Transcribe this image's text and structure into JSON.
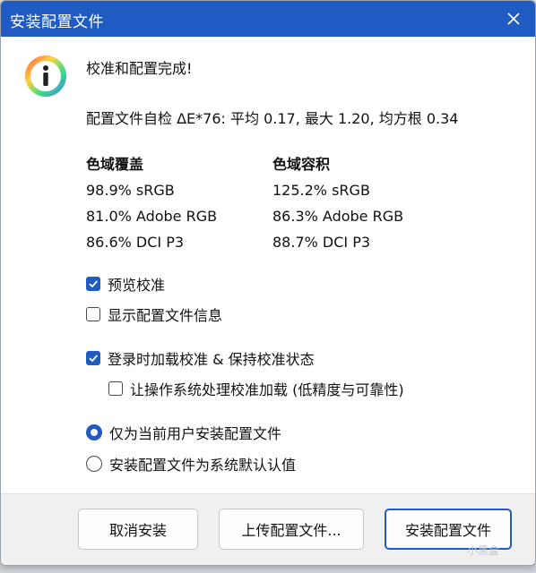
{
  "window": {
    "title": "安装配置文件"
  },
  "summary": {
    "heading": "校准和配置完成!",
    "self_check": "配置文件自检 ΔE*76: 平均 0.17, 最大 1.20, 均方根 0.34"
  },
  "gamut_coverage": {
    "title": "色域覆盖",
    "lines": [
      "98.9% sRGB",
      "81.0% Adobe RGB",
      "86.6% DCI P3"
    ]
  },
  "gamut_volume": {
    "title": "色域容积",
    "lines": [
      "125.2% sRGB",
      "86.3% Adobe RGB",
      "88.7% DCI P3"
    ]
  },
  "options": {
    "preview": {
      "label": "预览校准",
      "checked": true
    },
    "show_info": {
      "label": "显示配置文件信息",
      "checked": false
    },
    "load_on_login": {
      "label": "登录时加载校准 & 保持校准状态",
      "checked": true
    },
    "os_handle": {
      "label": "让操作系统处理校准加载 (低精度与可靠性)",
      "checked": false
    }
  },
  "install_scope": {
    "current_user": {
      "label": "仅为当前用户安装配置文件",
      "selected": true
    },
    "system_default": {
      "label": "安装配置文件为系统默认认值",
      "selected": false
    }
  },
  "buttons": {
    "cancel": "取消安装",
    "upload": "上传配置文件...",
    "install": "安装配置文件"
  },
  "watermark": "小黑盒",
  "colors": {
    "accent": "#1f5bc3",
    "titlebar": "#1f5bc3"
  }
}
